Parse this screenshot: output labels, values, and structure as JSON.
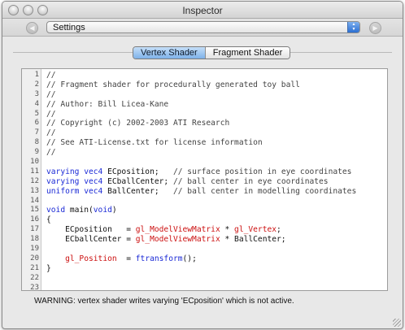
{
  "window": {
    "title": "Inspector"
  },
  "toolbar": {
    "back_icon": "chevron-left-icon",
    "forward_icon": "chevron-right-icon",
    "popup": {
      "selected": "Settings"
    }
  },
  "tabs": [
    {
      "label": "Vertex Shader",
      "active": true
    },
    {
      "label": "Fragment Shader",
      "active": false
    }
  ],
  "editor": {
    "lines": [
      {
        "n": "1",
        "tokens": [
          {
            "t": "//",
            "k": "c"
          }
        ]
      },
      {
        "n": "2",
        "tokens": [
          {
            "t": "// Fragment shader for procedurally generated toy ball",
            "k": "c"
          }
        ]
      },
      {
        "n": "3",
        "tokens": [
          {
            "t": "//",
            "k": "c"
          }
        ]
      },
      {
        "n": "4",
        "tokens": [
          {
            "t": "// Author: Bill Licea-Kane",
            "k": "c"
          }
        ]
      },
      {
        "n": "5",
        "tokens": [
          {
            "t": "//",
            "k": "c"
          }
        ]
      },
      {
        "n": "6",
        "tokens": [
          {
            "t": "// Copyright (c) 2002-2003 ATI Research",
            "k": "c"
          }
        ]
      },
      {
        "n": "7",
        "tokens": [
          {
            "t": "//",
            "k": "c"
          }
        ]
      },
      {
        "n": "8",
        "tokens": [
          {
            "t": "// See ATI-License.txt for license information",
            "k": "c"
          }
        ]
      },
      {
        "n": "9",
        "tokens": [
          {
            "t": "//",
            "k": "c"
          }
        ]
      },
      {
        "n": "10",
        "tokens": []
      },
      {
        "n": "11",
        "tokens": [
          {
            "t": "varying",
            "k": "kw"
          },
          {
            "t": " "
          },
          {
            "t": "vec4",
            "k": "kw"
          },
          {
            "t": " ECposition;   "
          },
          {
            "t": "// surface position in eye coordinates",
            "k": "c"
          }
        ]
      },
      {
        "n": "12",
        "tokens": [
          {
            "t": "varying",
            "k": "kw"
          },
          {
            "t": " "
          },
          {
            "t": "vec4",
            "k": "kw"
          },
          {
            "t": " ECballCenter; "
          },
          {
            "t": "// ball center in eye coordinates",
            "k": "c"
          }
        ]
      },
      {
        "n": "13",
        "tokens": [
          {
            "t": "uniform",
            "k": "kw"
          },
          {
            "t": " "
          },
          {
            "t": "vec4",
            "k": "kw"
          },
          {
            "t": " BallCenter;   "
          },
          {
            "t": "// ball center in modelling coordinates",
            "k": "c"
          }
        ]
      },
      {
        "n": "14",
        "tokens": []
      },
      {
        "n": "15",
        "tokens": [
          {
            "t": "void",
            "k": "kw"
          },
          {
            "t": " main("
          },
          {
            "t": "void",
            "k": "kw"
          },
          {
            "t": ")"
          }
        ]
      },
      {
        "n": "16",
        "tokens": [
          {
            "t": "{"
          }
        ]
      },
      {
        "n": "17",
        "tokens": [
          {
            "t": "    ECposition   = "
          },
          {
            "t": "gl_ModelViewMatrix",
            "k": "fn"
          },
          {
            "t": " * "
          },
          {
            "t": "gl_Vertex",
            "k": "fn"
          },
          {
            "t": ";"
          }
        ]
      },
      {
        "n": "18",
        "tokens": [
          {
            "t": "    ECballCenter = "
          },
          {
            "t": "gl_ModelViewMatrix",
            "k": "fn"
          },
          {
            "t": " * BallCenter;"
          }
        ]
      },
      {
        "n": "19",
        "tokens": []
      },
      {
        "n": "20",
        "tokens": [
          {
            "t": "    "
          },
          {
            "t": "gl_Position",
            "k": "fn"
          },
          {
            "t": "  = "
          },
          {
            "t": "ftransform",
            "k": "kw"
          },
          {
            "t": "();"
          }
        ]
      },
      {
        "n": "21",
        "tokens": [
          {
            "t": "}"
          }
        ]
      },
      {
        "n": "22",
        "tokens": []
      },
      {
        "n": "23",
        "tokens": []
      }
    ]
  },
  "status": {
    "text": "WARNING: vertex shader writes varying 'ECposition' which is not active."
  },
  "colors": {
    "keyword": "#1b2ad6",
    "builtin": "#cc1111",
    "comment": "#444444",
    "active_tab": "#7fb2ea"
  }
}
